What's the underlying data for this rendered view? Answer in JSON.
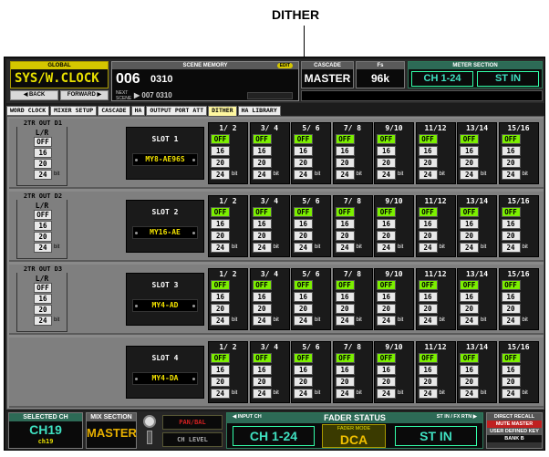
{
  "callout": {
    "label": "DITHER"
  },
  "top": {
    "global_tag": "GLOBAL",
    "global_value": "SYS/W.CLOCK",
    "back": "◀ BACK",
    "forward": "FORWARD ▶",
    "scene_tag": "SCENE MEMORY",
    "edit": "EDIT",
    "scene_number": "006",
    "scene_title": "0310",
    "next_label": "NEXT SCENE",
    "next_value": "▶ 007  0310",
    "cascade_tag": "CASCADE",
    "cascade_value": "MASTER",
    "fs_tag": "Fs",
    "fs_value": "96k",
    "meter_tag": "METER SECTION",
    "meter_a": "CH 1-24",
    "meter_b": "ST IN"
  },
  "tabs": [
    "WORD CLOCK",
    "MIXER SETUP",
    "CASCADE",
    "HA",
    "OUTPUT PORT ATT",
    "DITHER",
    "HA LIBRARY"
  ],
  "labels": {
    "bit": "bit",
    "lr": "L/R",
    "off": "OFF",
    "b16": "16",
    "b20": "20",
    "b24": "24"
  },
  "channels": [
    "1/ 2",
    "3/ 4",
    "5/ 6",
    "7/ 8",
    "9/10",
    "11/12",
    "13/14",
    "15/16"
  ],
  "rows": [
    {
      "tout": "2TR OUT D1",
      "slot": "SLOT 1",
      "card": "MY8-AE96S"
    },
    {
      "tout": "2TR OUT D2",
      "slot": "SLOT 2",
      "card": "MY16-AE"
    },
    {
      "tout": "2TR OUT D3",
      "slot": "SLOT 3",
      "card": "MY4-AD"
    },
    {
      "tout": "",
      "slot": "SLOT 4",
      "card": "MY4-DA"
    }
  ],
  "bottom": {
    "selch_tag": "SELECTED CH",
    "selch_value": "CH19",
    "selch_sub": "ch19",
    "mix_tag": "MIX SECTION",
    "mix_value": "MASTER",
    "panbal": "PAN/BAL",
    "chlevel": "CH LEVEL",
    "fader_tag": "FADER STATUS",
    "input_tag": "◀ INPUT CH",
    "stin_tag": "ST IN / FX RTN ▶",
    "input_value": "CH 1-24",
    "fmode_label": "FADER MODE",
    "fmode_value": "DCA",
    "stin_value": "ST IN",
    "recall_tag": "DIRECT RECALL",
    "mute_value": "MUTE MASTER",
    "udk_tag": "USER DEFINED KEY",
    "bank_value": "BANK B"
  },
  "colors": {
    "selected": "#7cf000",
    "accent_yellow": "#e8e000",
    "accent_cyan": "#3fe0c0"
  }
}
